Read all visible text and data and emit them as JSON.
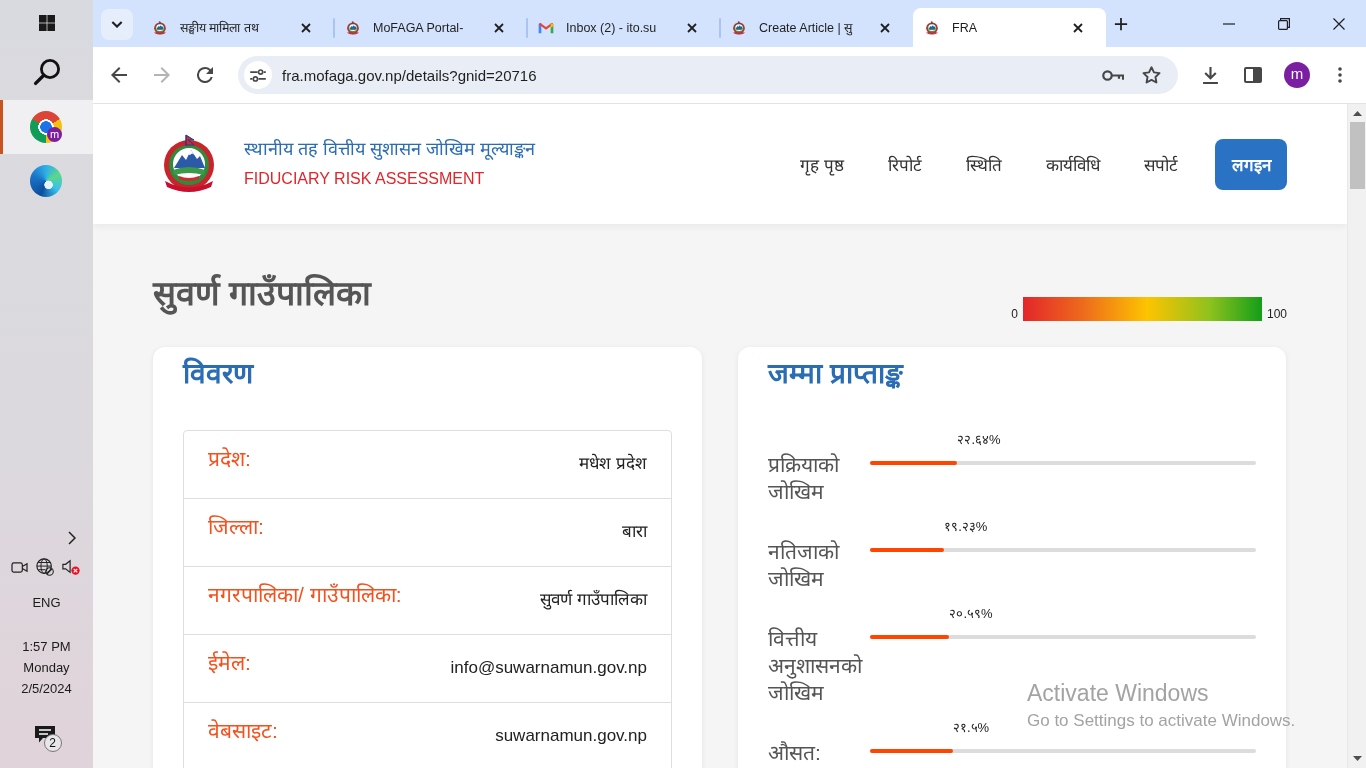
{
  "taskbar": {
    "apps": [
      {
        "selected": true,
        "badge": "m"
      },
      {
        "selected": false
      }
    ],
    "tray": {
      "volume_muted": true,
      "language": "ENG",
      "time": "1:57 PM",
      "day": "Monday",
      "date": "2/5/2024",
      "notification_count": "2"
    }
  },
  "browser": {
    "tabs": [
      {
        "title": "सङ्घीय मामिला तथ",
        "selected": false
      },
      {
        "title": "MoFAGA Portal-",
        "selected": false
      },
      {
        "title": "Inbox (2) - ito.su",
        "selected": false
      },
      {
        "title": "Create Article | सु",
        "selected": false
      },
      {
        "title": "FRA",
        "selected": true
      }
    ],
    "back_disabled": false,
    "forward_disabled": true,
    "url": "fra.mofaga.gov.np/details?gnid=20716",
    "profile_initial": "m"
  },
  "site": {
    "header": {
      "title": "स्थानीय तह वित्तीय सुशासन जोखिम मूल्याङ्कन",
      "subtitle": "FIDUCIARY RISK ASSESSMENT",
      "nav": [
        "गृह पृष्ठ",
        "रिपोर्ट",
        "स्थिति",
        "कार्यविधि",
        "सपोर्ट"
      ],
      "login": "लगइन"
    },
    "page_title": "सुवर्ण गाउँपालिका",
    "scale": {
      "min": "0",
      "max": "100"
    },
    "details": {
      "title": "विवरण",
      "rows": [
        {
          "label": "प्रदेश:",
          "value": "मधेश प्रदेश"
        },
        {
          "label": "जिल्ला:",
          "value": "बारा"
        },
        {
          "label": "नगरपालिका/ गाउँपालिका:",
          "value": "सुवर्ण गाउँपालिका"
        },
        {
          "label": "ईमेल:",
          "value": "info@suwarnamun.gov.np"
        },
        {
          "label": "वेबसाइट:",
          "value": "suwarnamun.gov.np"
        }
      ]
    },
    "scores": {
      "title": "जम्मा प्राप्ताङ्क",
      "rows": [
        {
          "label": "प्रक्रियाको जोखिम",
          "reading": "२२.६४%",
          "level": 0.2264
        },
        {
          "label": "नतिजाको जोखिम",
          "reading": "१९.२३%",
          "level": 0.1923
        },
        {
          "label": "वित्तीय अनुशासनको जोखिम",
          "reading": "२०.५९%",
          "level": 0.2059
        },
        {
          "label": "औसत:",
          "reading": "२१.५%",
          "level": 0.215
        }
      ]
    }
  },
  "activation_notice": {
    "title": "Activate Windows",
    "text": "Go to Settings to activate Windows."
  }
}
